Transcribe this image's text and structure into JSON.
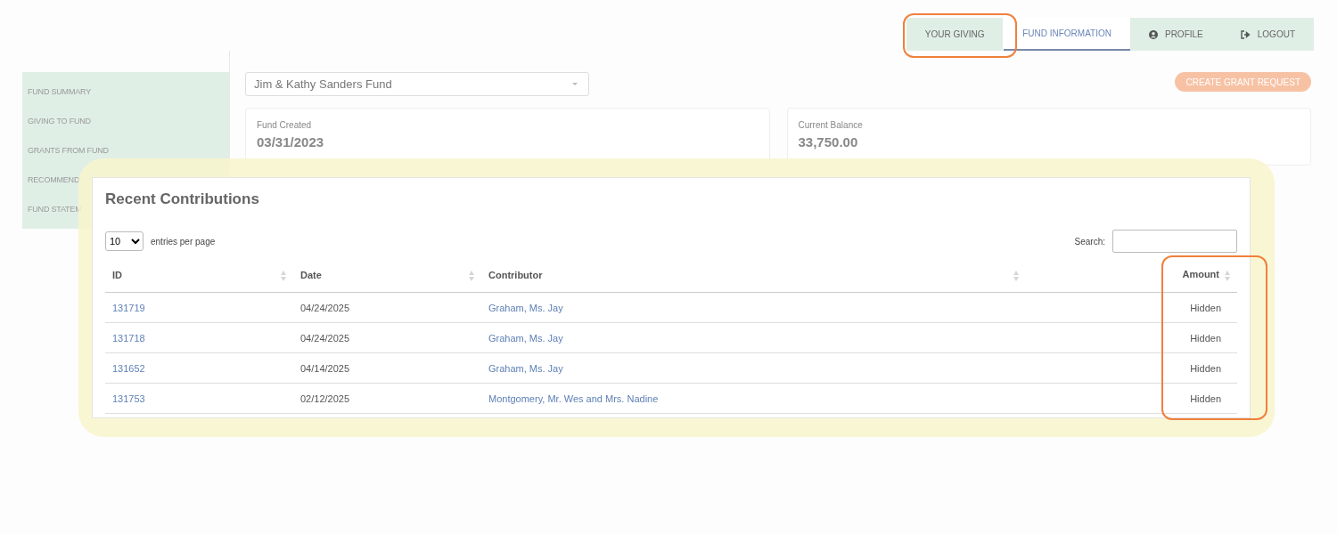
{
  "nav": {
    "tabs": [
      {
        "label": "YOUR GIVING",
        "selected": false
      },
      {
        "label": "FUND INFORMATION",
        "selected": true
      },
      {
        "label": "PROFILE",
        "selected": false
      },
      {
        "label": "LOGOUT",
        "selected": false
      }
    ]
  },
  "sidebar": {
    "items": [
      {
        "label": "FUND SUMMARY"
      },
      {
        "label": "GIVING TO FUND"
      },
      {
        "label": "GRANTS FROM FUND"
      },
      {
        "label": "RECOMMEND"
      },
      {
        "label": "FUND STATEM"
      }
    ]
  },
  "fund_select": {
    "value": "Jim & Kathy Sanders Fund"
  },
  "create_button": "CREATE GRANT REQUEST",
  "stats": [
    {
      "label": "Fund Created",
      "value": "03/31/2023"
    },
    {
      "label": "Current Balance",
      "value": "33,750.00"
    }
  ],
  "contributions": {
    "title": "Recent Contributions",
    "page_size": "10",
    "page_size_label": "entries per page",
    "search_label": "Search:",
    "columns": [
      {
        "label": "ID"
      },
      {
        "label": "Date"
      },
      {
        "label": "Contributor"
      },
      {
        "label": "Amount"
      }
    ],
    "rows": [
      [
        "131719",
        "04/24/2025",
        "Graham, Ms. Jay",
        "Hidden"
      ],
      [
        "131718",
        "04/24/2025",
        "Graham, Ms. Jay",
        "Hidden"
      ],
      [
        "131652",
        "04/14/2025",
        "Graham, Ms. Jay",
        "Hidden"
      ],
      [
        "131753",
        "02/12/2025",
        "Montgomery, Mr. Wes and Mrs. Nadine",
        "Hidden"
      ]
    ]
  }
}
